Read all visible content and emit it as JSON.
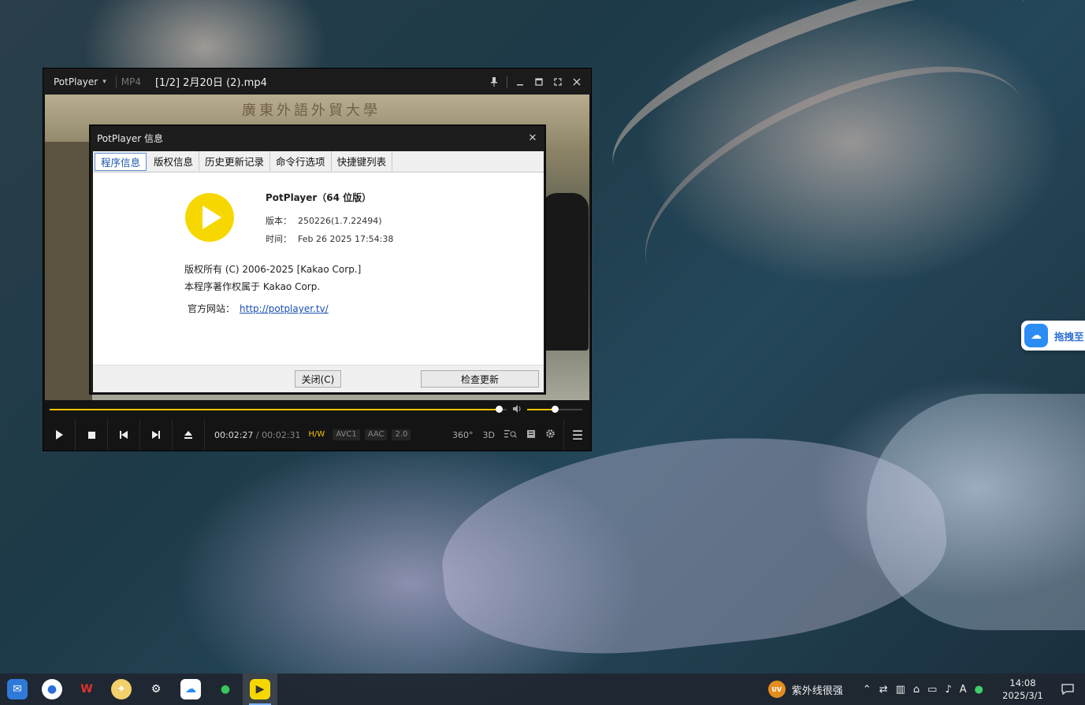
{
  "player": {
    "app_name": "PotPlayer",
    "format": "MP4",
    "file_title": "[1/2] 2月20日 (2).mp4",
    "video_banner": "廣東外語外貿大學",
    "progress_fraction": 0.982,
    "volume_fraction": 0.5,
    "time_current": "00:02:27",
    "time_separator": "/",
    "time_total": "00:02:31",
    "badges": [
      "H/W",
      "AVC1",
      "AAC",
      "2.0"
    ],
    "right_controls": {
      "vr": "360°",
      "three_d": "3D"
    }
  },
  "dialog": {
    "title": "PotPlayer 信息",
    "tabs": [
      "程序信息",
      "版权信息",
      "历史更新记录",
      "命令行选项",
      "快捷键列表"
    ],
    "product": "PotPlayer（64 位版）",
    "version_label": "版本：",
    "version_value": "250226(1.7.22494)",
    "time_label": "时间：",
    "time_value": "Feb 26 2025 17:54:38",
    "copyright_line1": "版权所有 (C) 2006-2025 [Kakao Corp.]",
    "copyright_line2": "本程序著作权属于 Kakao Corp.",
    "site_label": "官方网站：",
    "site_url": "http://potplayer.tv/",
    "close_button": "关闭(C)",
    "update_button": "检查更新"
  },
  "floating": {
    "label": "拖拽至"
  },
  "taskbar": {
    "tray_app_badge": "UV",
    "tray_app_label": "紫外线很强",
    "tray_glyphs": [
      "⌃",
      "⇄",
      "▥",
      "⌂",
      "▭",
      "♪",
      "A",
      "●"
    ],
    "time": "14:08",
    "date": "2025/3/1"
  },
  "colors": {
    "accent": "#f5c400",
    "link": "#1a4fb5",
    "logo": "#f6d800"
  }
}
